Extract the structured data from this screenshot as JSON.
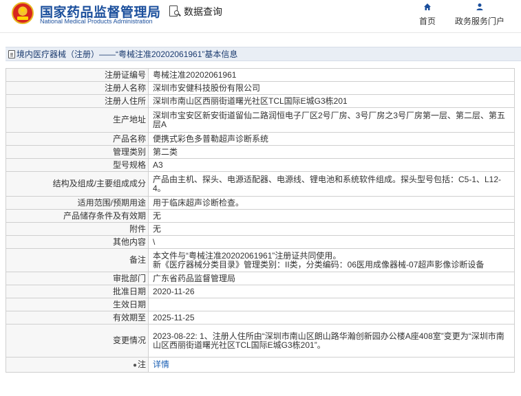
{
  "header": {
    "brand_cn": "国家药品监督管理局",
    "brand_en": "National Medical Products Administration",
    "query_label": "数据查询",
    "nav": [
      {
        "label": "首页",
        "icon": "home-icon"
      },
      {
        "label": "政务服务门户",
        "icon": "user-icon"
      }
    ]
  },
  "breadcrumb": {
    "text": "境内医疗器械（注册）——“粤械注准20202061961”基本信息"
  },
  "rows": [
    {
      "label": "注册证编号",
      "value": "粤械注准20202061961"
    },
    {
      "label": "注册人名称",
      "value": "深圳市安健科技股份有限公司"
    },
    {
      "label": "注册人住所",
      "value": "深圳市南山区西丽街道曙光社区TCL国际E城G3栋201"
    },
    {
      "label": "生产地址",
      "value": "深圳市宝安区新安街道留仙二路润恒电子厂区2号厂房、3号厂房之3号厂房第一层、第二层、第五层A"
    },
    {
      "label": "产品名称",
      "value": "便携式彩色多普勒超声诊断系统"
    },
    {
      "label": "管理类别",
      "value": "第二类"
    },
    {
      "label": "型号规格",
      "value": "A3"
    },
    {
      "label": "结构及组成/主要组成成分",
      "value": "产品由主机、探头、电源适配器、电源线、锂电池和系统软件组成。探头型号包括：C5-1、L12-4。"
    },
    {
      "label": "适用范围/预期用途",
      "value": "用于临床超声诊断检查。"
    },
    {
      "label": "产品储存条件及有效期",
      "value": "无"
    },
    {
      "label": "附件",
      "value": "无"
    },
    {
      "label": "其他内容",
      "value": "\\"
    },
    {
      "label": "备注",
      "value_lines": [
        "本文件与“粤械注准20202061961”注册证共同使用。",
        "新《医疗器械分类目录》管理类别：II类，分类编码：06医用成像器械-07超声影像诊断设备"
      ]
    },
    {
      "label": "审批部门",
      "value": "广东省药品监督管理局"
    },
    {
      "label": "批准日期",
      "value": "2020-11-26"
    },
    {
      "label": "生效日期",
      "value": ""
    },
    {
      "label": "有效期至",
      "value": "2025-11-25"
    },
    {
      "label": "变更情况",
      "value": "2023-08-22: 1、注册人住所由“深圳市南山区朗山路华瀚创新园办公楼A座408室”变更为“深圳市南山区西丽街道曙光社区TCL国际E城G3栋201”。"
    }
  ],
  "note_row": {
    "label": "注",
    "link_text": "详情"
  }
}
